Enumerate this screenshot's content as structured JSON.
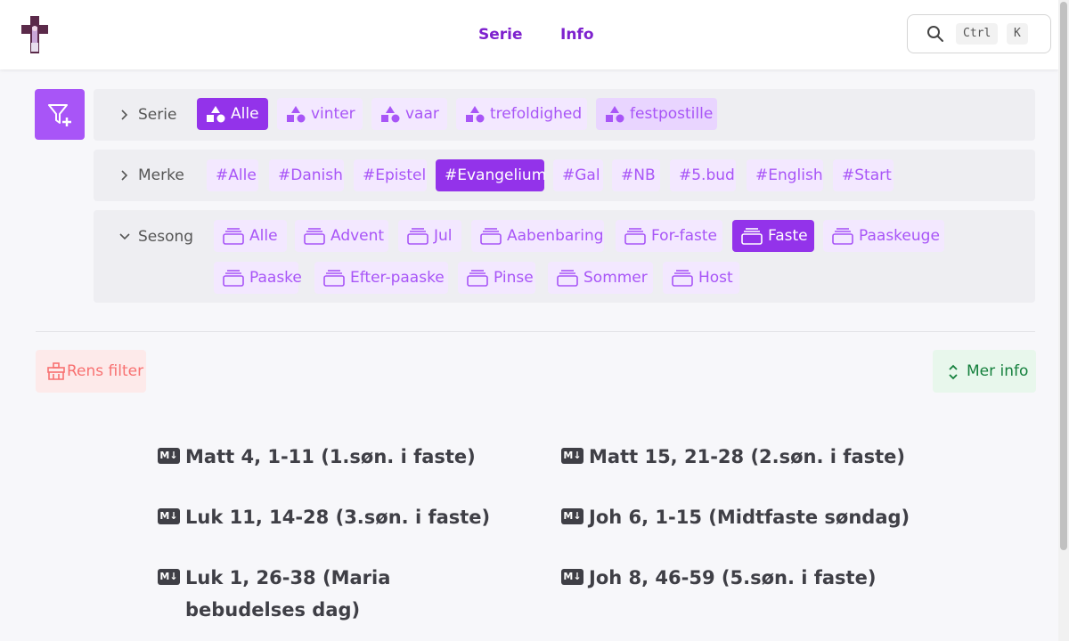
{
  "nav": {
    "links": [
      "Serie",
      "Info"
    ]
  },
  "search": {
    "keys": [
      "Ctrl",
      "K"
    ]
  },
  "filters": {
    "serie": {
      "label": "Serie",
      "chips": [
        "Alle",
        "vinter",
        "vaar",
        "trefoldighed",
        "festpostille"
      ],
      "selected": "Alle"
    },
    "merke": {
      "label": "Merke",
      "chips": [
        "#Alle",
        "#Danish",
        "#Epistel",
        "#Evangelium",
        "#Gal",
        "#NB",
        "#5.bud",
        "#English",
        "#Start"
      ],
      "selected": "#Evangelium"
    },
    "sesong": {
      "label": "Sesong",
      "chips": [
        "Alle",
        "Advent",
        "Jul",
        "Aabenbaring",
        "For-faste",
        "Faste",
        "Paaskeuge",
        "Paaske",
        "Efter-paaske",
        "Pinse",
        "Sommer",
        "Host"
      ],
      "selected": "Faste"
    }
  },
  "actions": {
    "clear_label": "Rens filter",
    "more_label": "Mer info"
  },
  "readings": [
    "Matt 4, 1-11 (1.søn. i faste)",
    "Matt 15, 21-28 (2.søn. i faste)",
    "Luk 11, 14-28 (3.søn. i faste)",
    "Joh 6, 1-15 (Midtfaste søndag)",
    "Luk 1, 26-38 (Maria bebudelses dag)",
    "Joh 8, 46-59 (5.søn. i faste)"
  ],
  "colors": {
    "accent": "#9333ea",
    "chip_bg": "#f3e8ff",
    "clear": "#f87171",
    "more": "#15803d"
  }
}
